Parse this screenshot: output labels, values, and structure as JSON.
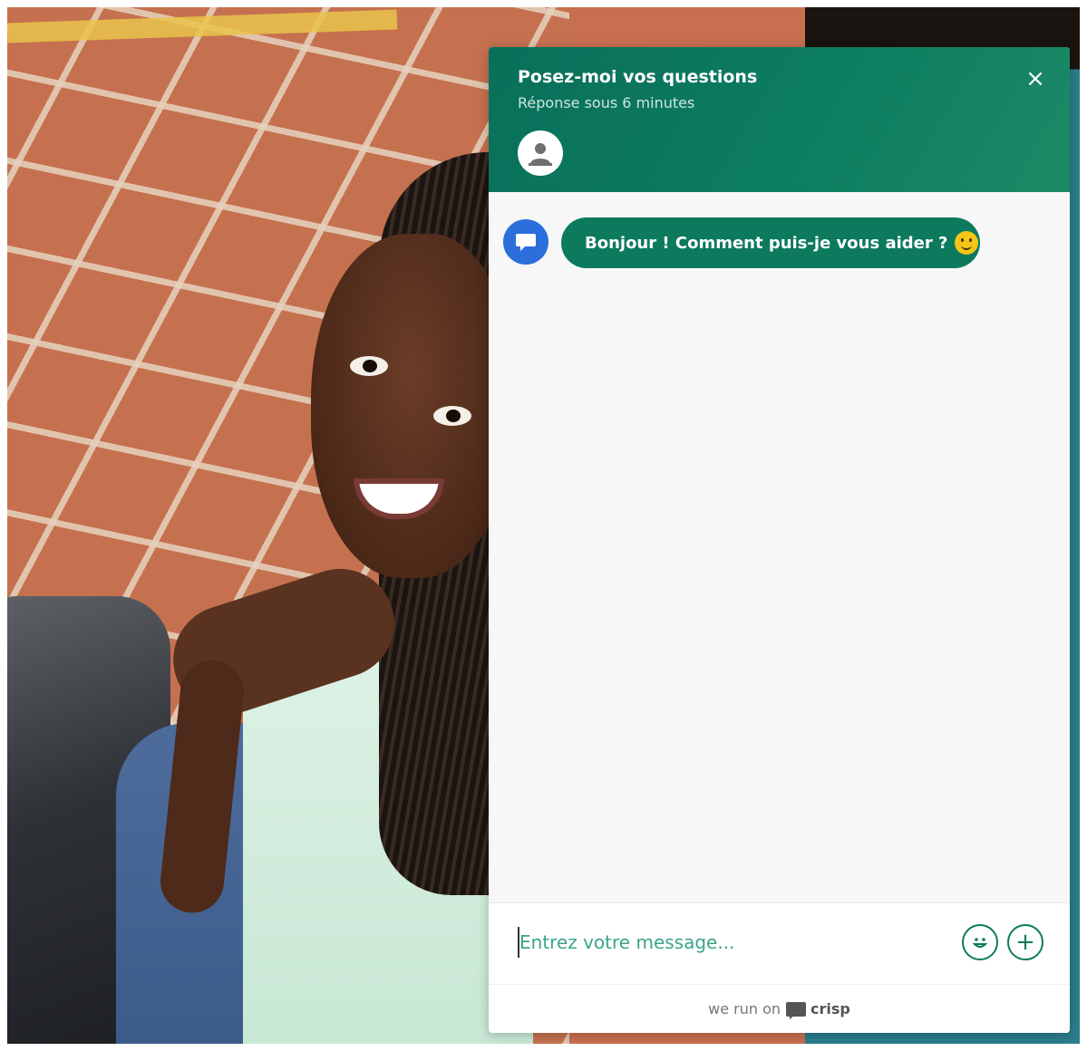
{
  "chat": {
    "title": "Posez-moi vos questions",
    "subtitle": "Réponse sous 6 minutes",
    "close_label": "×",
    "message": "Bonjour ! Comment puis-je vous aider ?",
    "input_placeholder": "Entrez votre message...",
    "plus_label": "+",
    "footer_prefix": "we run on",
    "footer_brand": "crisp",
    "colors": {
      "header": "#0c7d60",
      "bubble": "#0d7a5d",
      "bot_avatar": "#2c6fdc"
    },
    "icons": [
      "close-icon",
      "user-avatar-icon",
      "chat-bubble-icon",
      "smile-emoji-icon",
      "emoji-button-icon",
      "plus-icon",
      "crisp-logo-icon"
    ]
  },
  "background": {
    "description_icon": "photo-background"
  }
}
